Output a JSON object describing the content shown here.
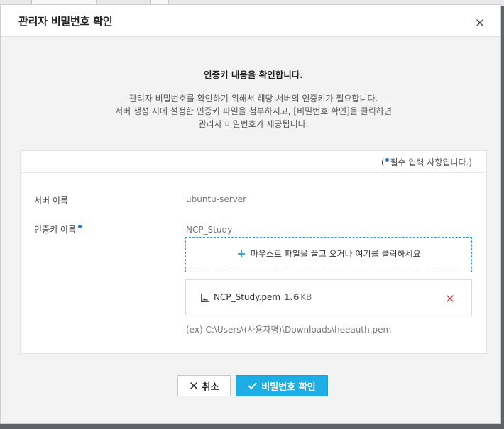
{
  "modal": {
    "title": "관리자 비밀번호 확인"
  },
  "intro": {
    "heading": "인증키 내용을 확인합니다.",
    "lines": [
      "관리자 비밀번호를 확인하기 위해서 해당 서버의 인증키가 필요합니다.",
      "서버 생성 시에 설정한 인증키 파일을 첨부하시고, [비밀번호 확인]을 클릭하면",
      "관리자 비밀번호가 제공됩니다."
    ]
  },
  "form": {
    "required_note_open": "(",
    "required_note_text": "필수 입력 사항입니다.)",
    "server_name_label": "서버 이름",
    "server_name_value": "ubuntu-server",
    "auth_key_label": "인증키 이름",
    "auth_key_value": "NCP_Study",
    "dropzone_text": "마우스로 파일을 끌고 오거나 여기를 클릭하세요",
    "file": {
      "name": "NCP_Study.pem",
      "size": "1.6",
      "size_unit": "KB"
    },
    "hint": "(ex) C:\\Users\\(사용자명)\\Downloads\\heeauth.pem"
  },
  "buttons": {
    "cancel": "취소",
    "confirm": "비밀번호 확인"
  },
  "colors": {
    "accent": "#1eaee6",
    "required_dot": "#1a73e8",
    "remove": "#e53935"
  }
}
